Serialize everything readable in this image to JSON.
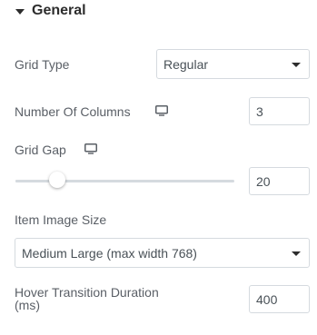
{
  "section": {
    "title": "General"
  },
  "grid_type": {
    "label": "Grid Type",
    "value": "Regular"
  },
  "columns": {
    "label": "Number Of Columns",
    "value": "3"
  },
  "grid_gap": {
    "label": "Grid Gap",
    "value": "20",
    "slider_fraction": 0.19
  },
  "image_size": {
    "label": "Item Image Size",
    "value": "Medium Large (max width 768)"
  },
  "hover_duration": {
    "label_line1": "Hover Transition Duration",
    "label_line2": "(ms)",
    "value": "400"
  },
  "icons": {
    "responsive": "monitor-icon",
    "section_toggle": "caret-down-icon",
    "dropdown": "chevron-down-icon"
  }
}
